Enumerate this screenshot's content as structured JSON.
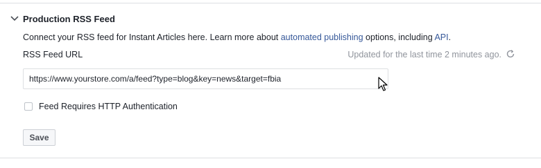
{
  "section": {
    "title": "Production RSS Feed",
    "expand_icon": "chevron-down-icon"
  },
  "description": {
    "prefix": "Connect your RSS feed for Instant Articles here. Learn more about ",
    "link_automated": "automated publishing",
    "middle": " options, including ",
    "link_api": "API",
    "suffix": "."
  },
  "rss_field": {
    "label": "RSS Feed URL",
    "value": "https://www.yourstore.com/a/feed?type=blog&key=news&target=fbia",
    "placeholder": ""
  },
  "status": {
    "text": "Updated for the last time 2 minutes ago.",
    "refresh_icon": "refresh-icon"
  },
  "auth_checkbox": {
    "label": "Feed Requires HTTP Authentication",
    "checked": false
  },
  "save_button": {
    "label": "Save"
  },
  "colors": {
    "link": "#365899",
    "text": "#1d2129",
    "muted": "#90949c",
    "border": "#dddfe2"
  }
}
